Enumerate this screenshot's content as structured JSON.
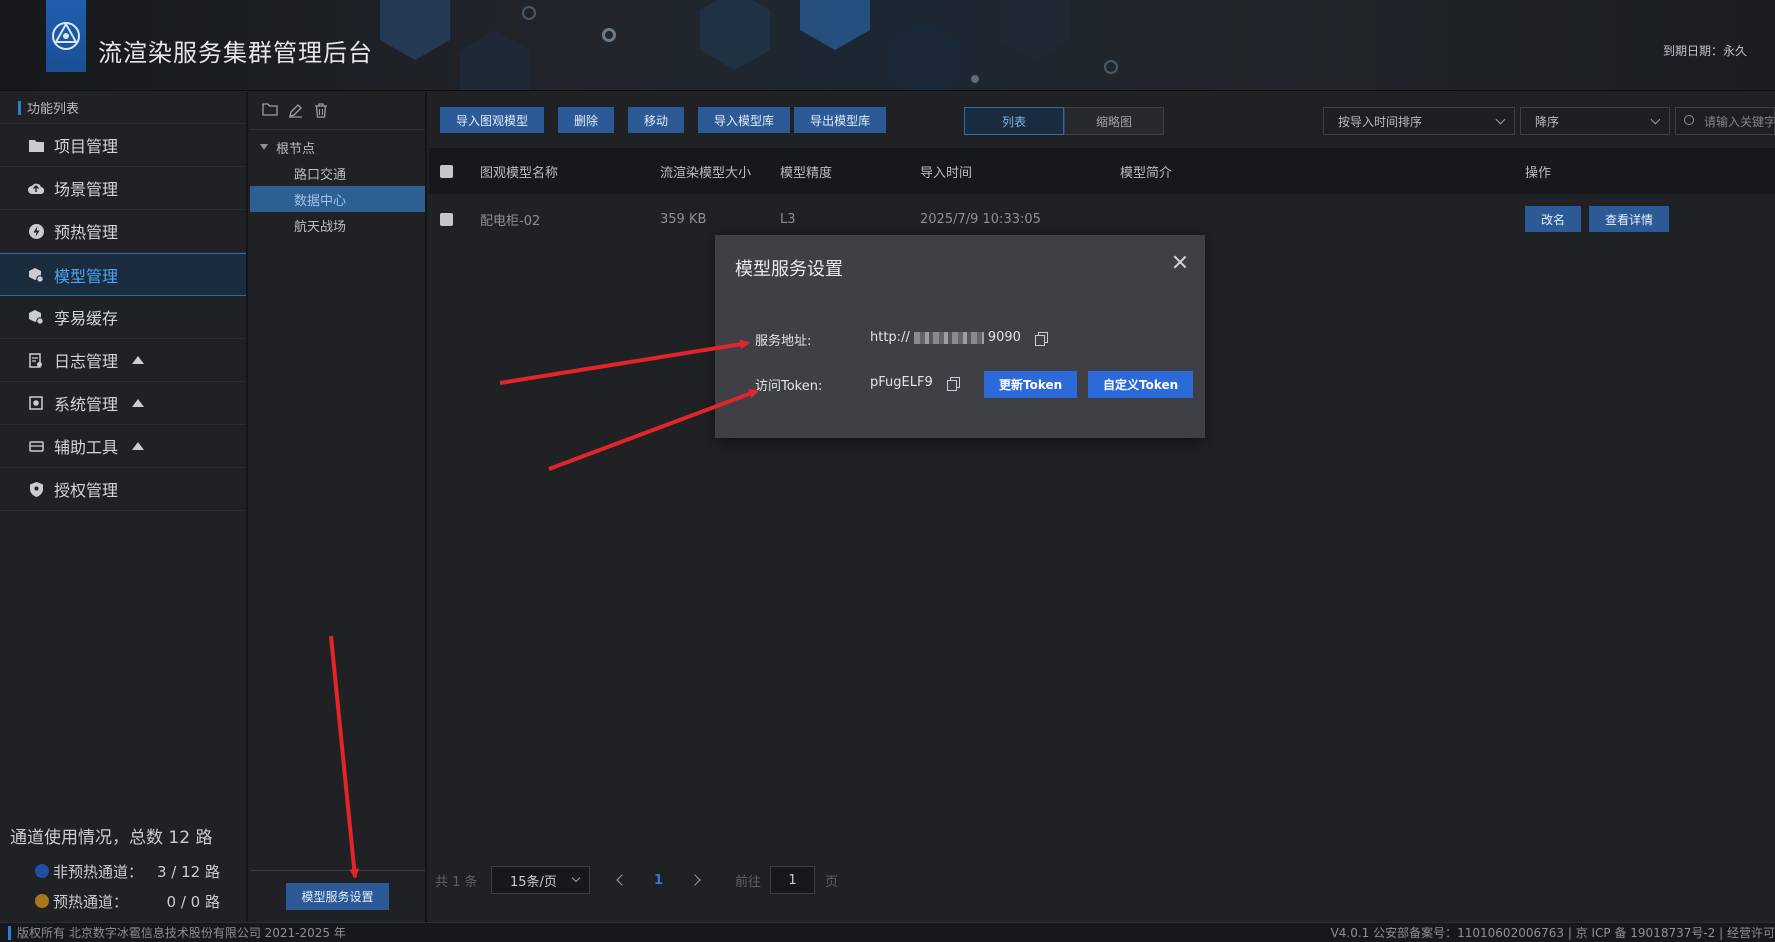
{
  "header": {
    "app_title": "流渲染服务集群管理后台",
    "expiry": "到期日期：永久"
  },
  "sidebar": {
    "heading": "功能列表",
    "items": [
      {
        "label": "项目管理",
        "icon": "folder-icon",
        "active": false,
        "expandable": false
      },
      {
        "label": "场景管理",
        "icon": "cloud-upload-icon",
        "active": false,
        "expandable": false
      },
      {
        "label": "预热管理",
        "icon": "lightning-icon",
        "active": false,
        "expandable": false
      },
      {
        "label": "模型管理",
        "icon": "cube-gear-icon",
        "active": true,
        "expandable": false
      },
      {
        "label": "孪易缓存",
        "icon": "cube-gear-icon",
        "active": false,
        "expandable": false
      },
      {
        "label": "日志管理",
        "icon": "log-icon",
        "active": false,
        "expandable": true
      },
      {
        "label": "系统管理",
        "icon": "system-icon",
        "active": false,
        "expandable": true
      },
      {
        "label": "辅助工具",
        "icon": "tool-icon",
        "active": false,
        "expandable": true
      },
      {
        "label": "授权管理",
        "icon": "shield-icon",
        "active": false,
        "expandable": false
      }
    ],
    "channels": {
      "title": "通道使用情况，总数 12 路",
      "non_preheat_label": "非预热通道：",
      "non_preheat_value": "3 / 12 路",
      "non_preheat_color": "#1f4fa8",
      "preheat_label": "预热通道：",
      "preheat_value": "0 / 0 路",
      "preheat_color": "#a8761b"
    }
  },
  "tree": {
    "root": "根节点",
    "children": [
      "路口交通",
      "数据中心",
      "航天战场"
    ],
    "selected": "数据中心",
    "footer_button": "模型服务设置"
  },
  "toolbar": {
    "import_model": "导入图观模型",
    "delete": "删除",
    "move": "移动",
    "import_library": "导入模型库",
    "export_library": "导出模型库",
    "view_list": "列表",
    "view_thumb": "缩略图",
    "sort_by": "按导入时间排序",
    "sort_order": "降序",
    "search_placeholder": "请输入关键字"
  },
  "table": {
    "columns": {
      "name": "图观模型名称",
      "size": "流渲染模型大小",
      "precision": "模型精度",
      "import_time": "导入时间",
      "desc": "模型简介",
      "ops": "操作"
    },
    "rows": [
      {
        "name": "配电柜-02",
        "size": "359 KB",
        "precision": "L3",
        "import_time": "2025/7/9 10:33:05",
        "desc": "",
        "rename": "改名",
        "details": "查看详情"
      }
    ]
  },
  "pager": {
    "total": "共 1 条",
    "page_size": "15条/页",
    "current": "1",
    "goto_label": "前往",
    "goto_value": "1",
    "page_suffix": "页"
  },
  "footer": {
    "copyright": "版权所有 北京数字冰雹信息技术股份有限公司 2021-2025 年",
    "version": "V4.0.1 公安部备案号：11010602006763 | 京 ICP 备 19018737号-2 | 经营许可"
  },
  "modal": {
    "title": "模型服务设置",
    "address_label": "服务地址:",
    "address_prefix": "http://",
    "address_suffix": "9090",
    "token_label": "访问Token:",
    "token_value": "pFugELF9",
    "refresh_token": "更新Token",
    "custom_token": "自定义Token"
  },
  "colors": {
    "accent": "#2c5a96",
    "primary_button": "#2d6ad9",
    "active_nav": "#4da3f7",
    "annotation_arrow": "#e3242b"
  }
}
